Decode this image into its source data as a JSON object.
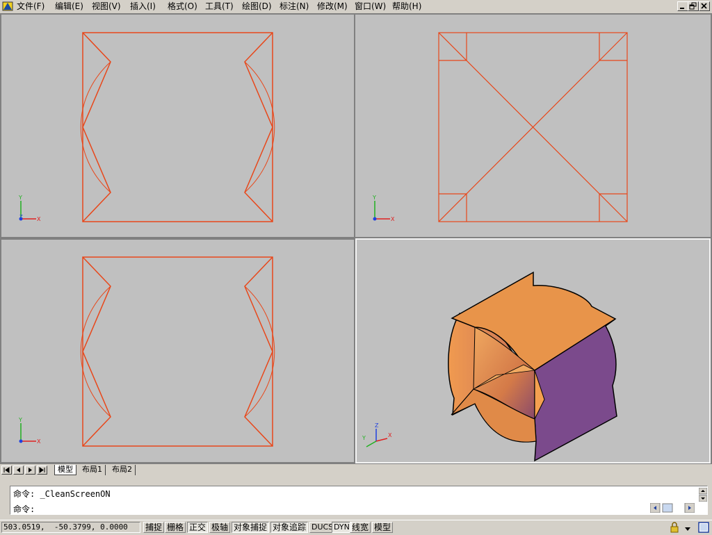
{
  "menu": {
    "items": [
      "文件(F)",
      "编辑(E)",
      "视图(V)",
      "插入(I)",
      "格式(O)",
      "工具(T)",
      "绘图(D)",
      "标注(N)",
      "修改(M)",
      "窗口(W)",
      "帮助(H)"
    ]
  },
  "window_controls": {
    "minimize": "_",
    "restore": "❐",
    "close": "✕"
  },
  "ucs": {
    "x": "X",
    "y": "Y",
    "z": "Z"
  },
  "colors": {
    "drawing_line": "#e8471a",
    "viewport_bg": "#c0c0c0",
    "solid_orange": "#e8944a",
    "solid_purple": "#7b4a8c"
  },
  "tabs": [
    "模型",
    "布局1",
    "布局2"
  ],
  "nav_buttons": [
    "|◀",
    "◀",
    "▶",
    "▶|"
  ],
  "command": {
    "history_line": "命令: _CleanScreenON",
    "prompt": "命令:"
  },
  "status": {
    "coordinates": "503.0519,  -50.3799, 0.0000",
    "buttons": [
      {
        "label": "捕捉",
        "on": false
      },
      {
        "label": "栅格",
        "on": false
      },
      {
        "label": "正交",
        "on": true
      },
      {
        "label": "极轴",
        "on": false
      },
      {
        "label": "对象捕捉",
        "on": true
      },
      {
        "label": "对象追踪",
        "on": true
      },
      {
        "label": "DUCS",
        "on": false
      },
      {
        "label": "DYN",
        "on": true
      },
      {
        "label": "线宽",
        "on": false
      },
      {
        "label": "模型",
        "on": false
      }
    ]
  }
}
